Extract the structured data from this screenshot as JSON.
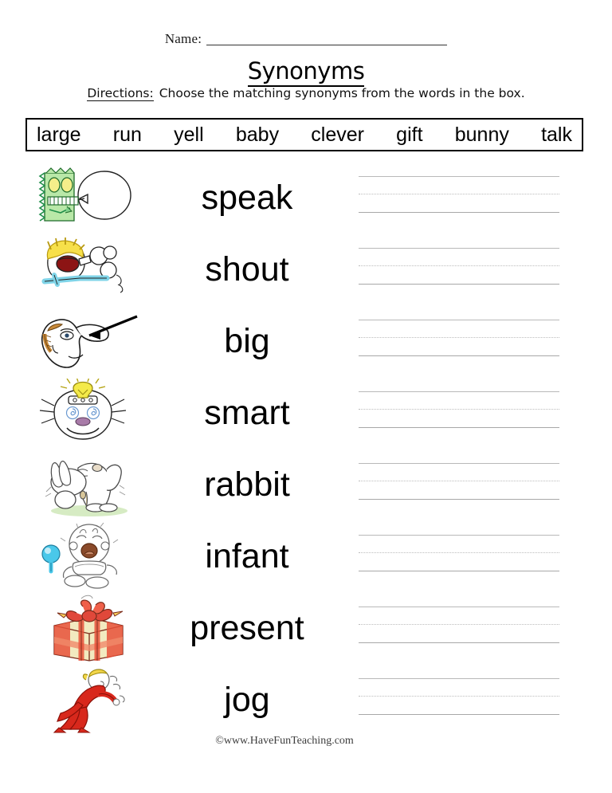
{
  "header": {
    "name_label": "Name:",
    "title": "Synonyms",
    "directions_label": "Directions:",
    "directions_text": "Choose the matching synonyms from the words in the box."
  },
  "word_bank": {
    "words": [
      "large",
      "run",
      "yell",
      "baby",
      "clever",
      "gift",
      "bunny",
      "talk"
    ]
  },
  "rows": [
    {
      "word": "speak",
      "image": "monster-with-speech-bubble"
    },
    {
      "word": "shout",
      "image": "boy-yelling-into-megaphone"
    },
    {
      "word": "big",
      "image": "face-with-big-nose-and-arrow"
    },
    {
      "word": "smart",
      "image": "face-with-lightbulb"
    },
    {
      "word": "rabbit",
      "image": "white-bunny-on-grass"
    },
    {
      "word": "infant",
      "image": "crying-baby-with-rattle"
    },
    {
      "word": "present",
      "image": "red-gift-box-with-bow"
    },
    {
      "word": "jog",
      "image": "running-person-in-red"
    }
  ],
  "footer": {
    "copyright": "©www.HaveFunTeaching.com"
  },
  "colors": {
    "page_background": "#ffffff",
    "ink": "#000000",
    "rule_solid": "#b9b9b9",
    "rule_dashed": "#bdbdbd",
    "box_border": "#000000",
    "footer_text": "#3d3d3d"
  }
}
